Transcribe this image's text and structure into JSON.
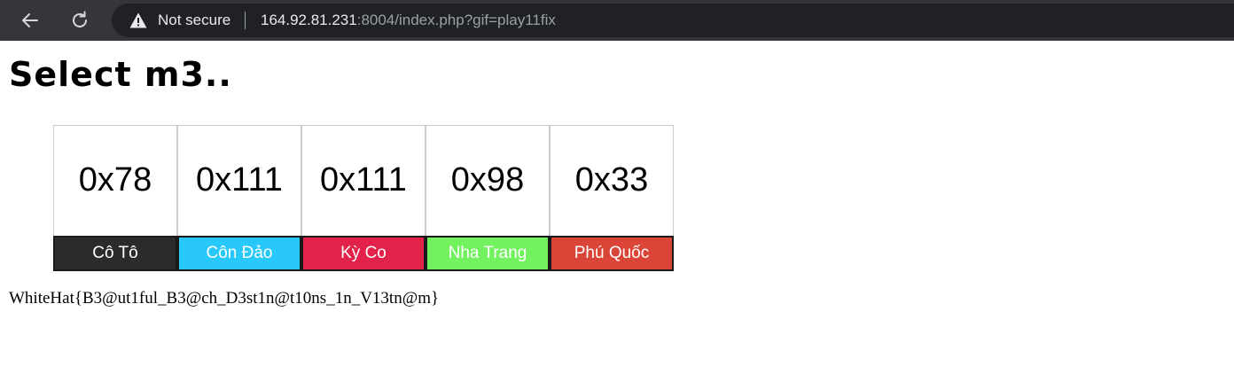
{
  "browser": {
    "security_label": "Not secure",
    "url_host": "164.92.81.231",
    "url_rest": ":8004/index.php?gif=play11fix"
  },
  "page": {
    "title": "Select m3..",
    "tiles": [
      {
        "value": "0x78",
        "label": "Cô Tô",
        "color": "#2b2b2b"
      },
      {
        "value": "0x111",
        "label": "Côn Đảo",
        "color": "#29c8fb"
      },
      {
        "value": "0x111",
        "label": "Kỳ Co",
        "color": "#e2224a"
      },
      {
        "value": "0x98",
        "label": "Nha Trang",
        "color": "#72f25e"
      },
      {
        "value": "0x33",
        "label": "Phú Quốc",
        "color": "#db4537"
      }
    ],
    "flag": "WhiteHat{B3@ut1ful_B3@ch_D3st1n@t10ns_1n_V13tn@m}"
  },
  "icons": {
    "back": "back-arrow-icon",
    "reload": "reload-icon",
    "warning": "warning-icon"
  }
}
